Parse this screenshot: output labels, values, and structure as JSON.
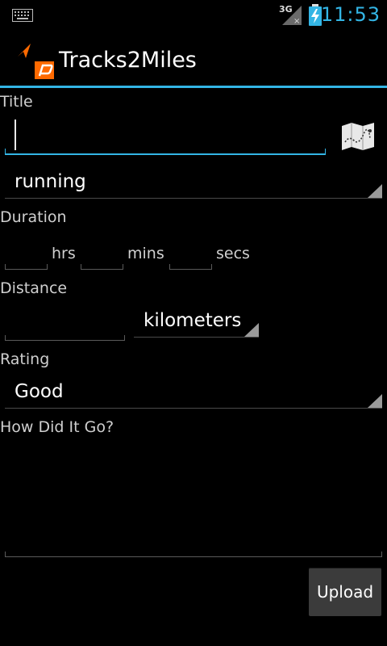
{
  "status_bar": {
    "time": "11:53",
    "network_label": "3G",
    "icons": [
      "keyboard-icon",
      "signal-icon",
      "battery-charging-icon"
    ]
  },
  "action_bar": {
    "title": "Tracks2Miles",
    "icons": [
      "app-logo-icon",
      "arrow-icon"
    ]
  },
  "form": {
    "title_label": "Title",
    "title_value": "",
    "activity_spinner": "running",
    "duration_label": "Duration",
    "duration_units": {
      "hours": "hrs",
      "minutes": "mins",
      "seconds": "secs"
    },
    "distance_label": "Distance",
    "distance_unit_spinner": "kilometers",
    "rating_label": "Rating",
    "rating_spinner": "Good",
    "notes_label": "How Did It Go?",
    "notes_value": "",
    "upload_label": "Upload"
  },
  "colors": {
    "accent": "#33b5e5",
    "background": "#000000",
    "button": "#3b3b3b"
  }
}
